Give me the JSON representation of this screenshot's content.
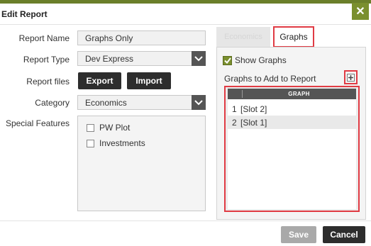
{
  "dialog": {
    "title": "Edit Report"
  },
  "form": {
    "report_name_label": "Report Name",
    "report_name_value": "Graphs Only",
    "report_type_label": "Report Type",
    "report_type_value": "Dev Express",
    "report_files_label": "Report files",
    "export_label": "Export",
    "import_label": "Import",
    "category_label": "Category",
    "category_value": "Economics",
    "special_features_label": "Special Features",
    "features": [
      {
        "label": "PW Plot",
        "checked": false
      },
      {
        "label": "Investments",
        "checked": false
      }
    ]
  },
  "tabs": [
    {
      "label": "Economics",
      "active": false
    },
    {
      "label": "Graphs",
      "active": true
    }
  ],
  "graphs_panel": {
    "show_graphs_label": "Show Graphs",
    "show_graphs_checked": true,
    "graphs_to_add_label": "Graphs to Add to Report",
    "grid_header": "GRAPH",
    "rows": [
      {
        "index": "1",
        "value": "[Slot 2]"
      },
      {
        "index": "2",
        "value": "[Slot 1]"
      }
    ]
  },
  "footer": {
    "save_label": "Save",
    "cancel_label": "Cancel"
  },
  "icons": {
    "close": "close-icon",
    "add": "add-icon",
    "dropdown": "chevron-down-icon",
    "check": "check-icon"
  },
  "colors": {
    "accent": "#7a8f2e",
    "highlight": "#e03b44",
    "dark_button": "#2d2d2d",
    "disabled_button": "#a9a9a9"
  }
}
